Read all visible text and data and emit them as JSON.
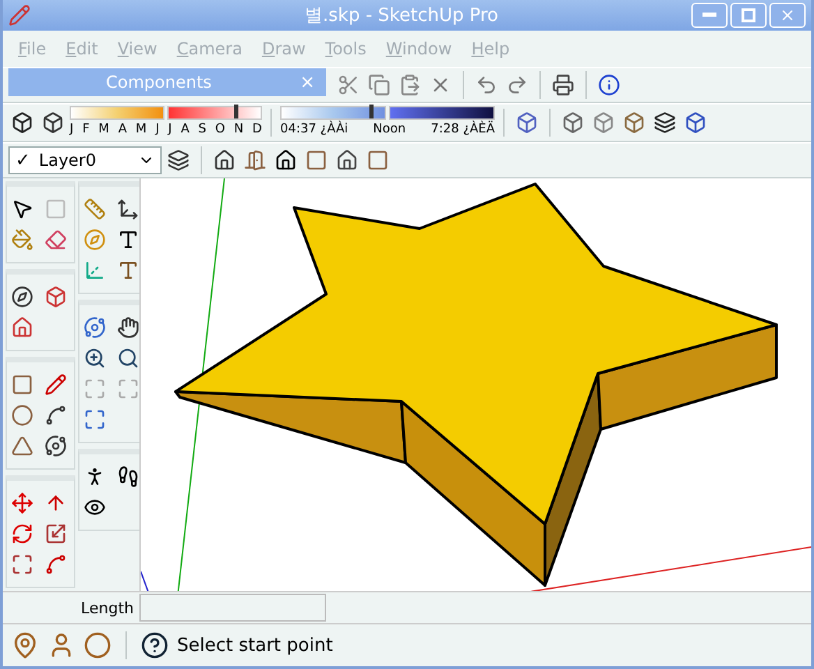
{
  "window": {
    "title": "별.skp - SketchUp Pro"
  },
  "menu": [
    {
      "label": "File",
      "disabled": true
    },
    {
      "label": "Edit",
      "disabled": true
    },
    {
      "label": "View",
      "disabled": true
    },
    {
      "label": "Camera",
      "disabled": true
    },
    {
      "label": "Draw",
      "disabled": true
    },
    {
      "label": "Tools",
      "disabled": true
    },
    {
      "label": "Window",
      "disabled": true
    },
    {
      "label": "Help",
      "disabled": true
    }
  ],
  "components_panel": {
    "title": "Components",
    "close": "×"
  },
  "month_slider": {
    "level": 0.86
  },
  "time_slider": {
    "level": 0.42
  },
  "shadow_bar": {
    "months": [
      "J",
      "F",
      "M",
      "A",
      "M",
      "J",
      "J",
      "A",
      "S",
      "O",
      "N",
      "D"
    ],
    "times": [
      "04:37 ¿ÀÀi",
      "Noon",
      "7:28 ¿ÀÈÄ"
    ]
  },
  "layer": {
    "mark": "✓",
    "name": "Layer0"
  },
  "measurements": {
    "label": "Length"
  },
  "status": {
    "text": "Select start point"
  }
}
